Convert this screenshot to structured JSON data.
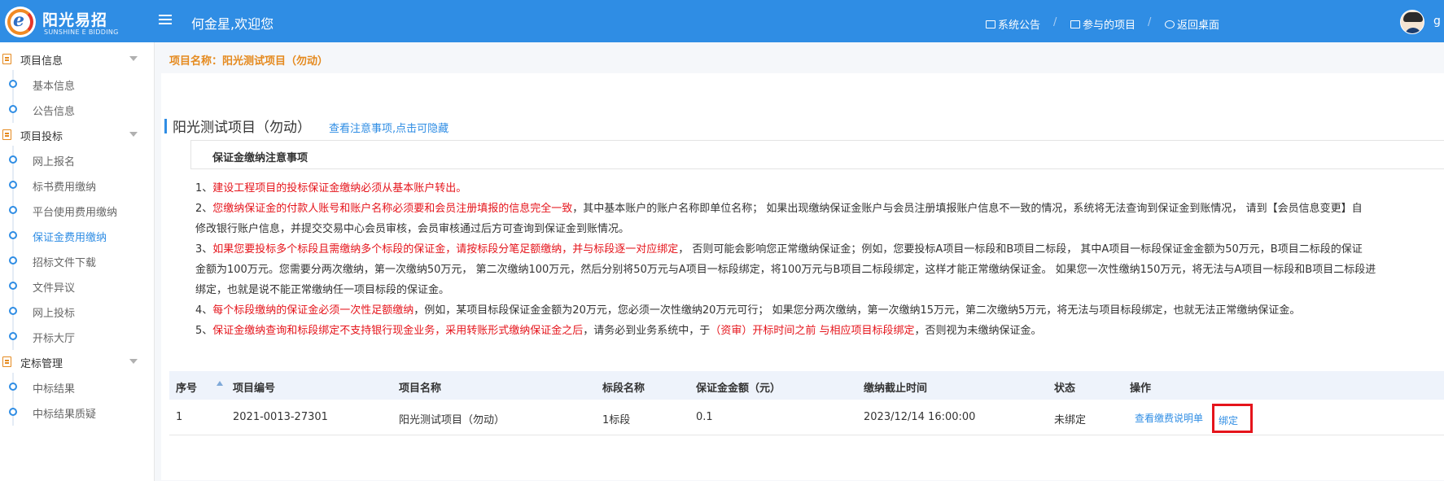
{
  "header": {
    "logo_cn": "阳光易招",
    "logo_en": "SUNSHINE E BIDDING",
    "welcome": "何金星,欢迎您",
    "nav": [
      {
        "label": "系统公告",
        "icon": "mail-icon"
      },
      {
        "label": "参与的项目",
        "icon": "briefcase-icon"
      },
      {
        "label": "返回桌面",
        "icon": "refresh-icon"
      }
    ],
    "separator": "/",
    "user_short": "g"
  },
  "sidebar": {
    "groups": [
      {
        "label": "项目信息",
        "items": [
          "基本信息",
          "公告信息"
        ]
      },
      {
        "label": "项目投标",
        "items": [
          "网上报名",
          "标书费用缴纳",
          "平台使用费用缴纳",
          "保证金费用缴纳",
          "招标文件下载",
          "文件异议",
          "网上投标",
          "开标大厅"
        ]
      },
      {
        "label": "定标管理",
        "items": [
          "中标结果",
          "中标结果质疑"
        ]
      }
    ],
    "active_item": "保证金费用缴纳"
  },
  "main": {
    "breadcrumb": "项目名称：阳光测试项目（勿动）",
    "title": "阳光测试项目（勿动）",
    "toggle_link": "查看注意事项,点击可隐藏",
    "notice": {
      "heading": "保证金缴纳注意事项",
      "l1_prefix": "1、",
      "l1_red": "建设工程项目的投标保证金缴纳必须从基本账户转出。",
      "l2_prefix": "2、",
      "l2_red": "您缴纳保证金的付款人账号和账户名称必须要和会员注册填报的信息完全一致",
      "l2_rest": "，其中基本账户的账户名称即单位名称； 如果出现缴纳保证金账户与会员注册填报账户信息不一致的情况，系统将无法查询到保证金到账情况， 请到【会员信息变更】自",
      "l2b": "修改银行账户信息，并提交交易中心会员审核，会员审核通过后方可查询到保证金到账情况。",
      "l3_prefix": "3、",
      "l3_red": "如果您要投标多个标段且需缴纳多个标段的保证金，请按标段分笔足额缴纳，并与标段逐一对应绑定",
      "l3_rest": "， 否则可能会影响您正常缴纳保证金；例如，您要投标A项目一标段和B项目二标段， 其中A项目一标段保证金金额为50万元，B项目二标段的保证",
      "l3b": "金额为100万元。您需要分两次缴纳，第一次缴纳50万元， 第二次缴纳100万元，然后分别将50万元与A项目一标段绑定，将100万元与B项目二标段绑定，这样才能正常缴纳保证金。 如果您一次性缴纳150万元，将无法与A项目一标段和B项目二标段进",
      "l3c": "绑定，也就是说不能正常缴纳任一项目标段的保证金。",
      "l4_prefix": "4、",
      "l4_red": "每个标段缴纳的保证金必须一次性足额缴纳",
      "l4_rest": "，例如，某项目标段保证金金额为20万元，您必须一次性缴纳20万元可行； 如果您分两次缴纳，第一次缴纳15万元，第二次缴纳5万元，将无法与项目标段绑定，也就无法正常缴纳保证金。",
      "l5_prefix": "5、",
      "l5_red": "保证金缴纳查询和标段绑定不支持银行现金业务，采用转账形式缴纳保证金之后",
      "l5_mid": "，请务必到业务系统中，于",
      "l5_red2": "（资审）开标时间之前 与相应项目标段绑定",
      "l5_end": "，否则视为未缴纳保证金。"
    },
    "table": {
      "columns": [
        "序号",
        "项目编号",
        "项目名称",
        "标段名称",
        "保证金金额（元）",
        "缴纳截止时间",
        "状态",
        "操作"
      ],
      "rows": [
        {
          "index": "1",
          "code": "2021-0013-27301",
          "name": "阳光测试项目（勿动）",
          "section": "1标段",
          "amount": "0.1",
          "deadline": "2023/12/14 16:00:00",
          "status": "未绑定",
          "action_view": "查看缴费说明单",
          "action_bind": "绑定"
        }
      ]
    }
  },
  "colors": {
    "header_bg": "#2f8de4",
    "accent": "#2f8de4",
    "warning_red": "#e5141b",
    "breadcrumb_orange": "#e58a1f"
  }
}
